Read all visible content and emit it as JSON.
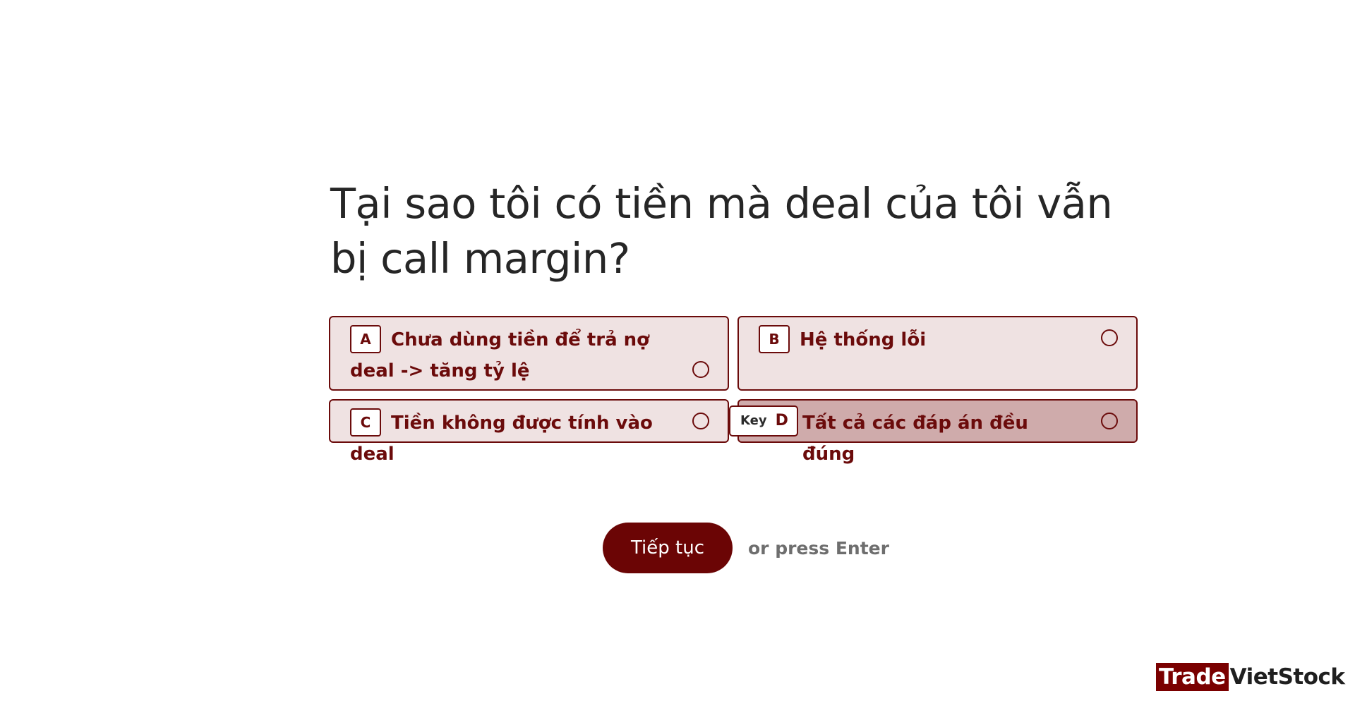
{
  "question": {
    "text": "Tại sao tôi có tiền mà deal của tôi vẫn bị call margin?"
  },
  "options": [
    {
      "letter": "A",
      "text": "Chưa dùng tiền để trả nợ deal -> tăng tỷ lệ",
      "selected": false
    },
    {
      "letter": "B",
      "text": "Hệ thống lỗi",
      "selected": false
    },
    {
      "letter": "C",
      "text": "Tiền không được tính vào deal",
      "selected": false
    },
    {
      "letter": "D",
      "text": "Tất cả các đáp án đều đúng",
      "selected": true
    }
  ],
  "key_hint": {
    "label": "Key",
    "letter": "D"
  },
  "actions": {
    "continue_label": "Tiếp tục",
    "enter_hint": "or press Enter"
  },
  "brand": {
    "part1": "Trade",
    "part2": "VietStock"
  },
  "colors": {
    "accent": "#6b0b0b",
    "option_bg": "#efe2e2",
    "option_selected_bg": "#cfabab",
    "button_bg": "#6b0505"
  }
}
